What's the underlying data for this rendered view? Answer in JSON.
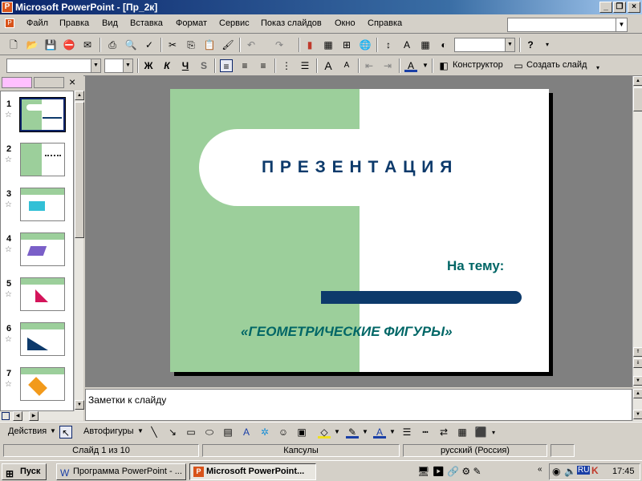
{
  "window": {
    "title": "Microsoft PowerPoint - [Пр_2к]",
    "app_icon": "powerpoint-icon"
  },
  "menu": [
    "Файл",
    "Правка",
    "Вид",
    "Вставка",
    "Формат",
    "Сервис",
    "Показ слайдов",
    "Окно",
    "Справка"
  ],
  "help_box": {
    "value": ""
  },
  "toolbar_standard": {
    "zoom_value": ""
  },
  "toolbar_format": {
    "font_value": "",
    "size_value": "",
    "bold": "Ж",
    "italic": "К",
    "underline": "Ч",
    "shadow": "S",
    "designer": "Конструктор",
    "new_slide": "Создать слайд"
  },
  "slides_pane": {
    "numbers": [
      "1",
      "2",
      "3",
      "4",
      "5",
      "6",
      "7"
    ]
  },
  "slide": {
    "title": "П Р Е З Е Н Т А Ц И Я",
    "subtitle_label": "На тему:",
    "topic": "«ГЕОМЕТРИЧЕСКИЕ ФИГУРЫ»",
    "colors": {
      "green": "#9ccf9b",
      "navy": "#0d3a6b",
      "teal": "#006666"
    }
  },
  "notes": {
    "placeholder": "Заметки к слайду"
  },
  "drawing_toolbar": {
    "actions": "Действия",
    "autoshapes": "Автофигуры"
  },
  "status": {
    "slide": "Слайд 1 из 10",
    "design": "Капсулы",
    "language": "русский (Россия)"
  },
  "taskbar": {
    "start": "Пуск",
    "task1": "Программа PowerPoint - ...",
    "task2": "Microsoft PowerPoint...",
    "tray_lang": "RU",
    "clock": "17:45"
  }
}
